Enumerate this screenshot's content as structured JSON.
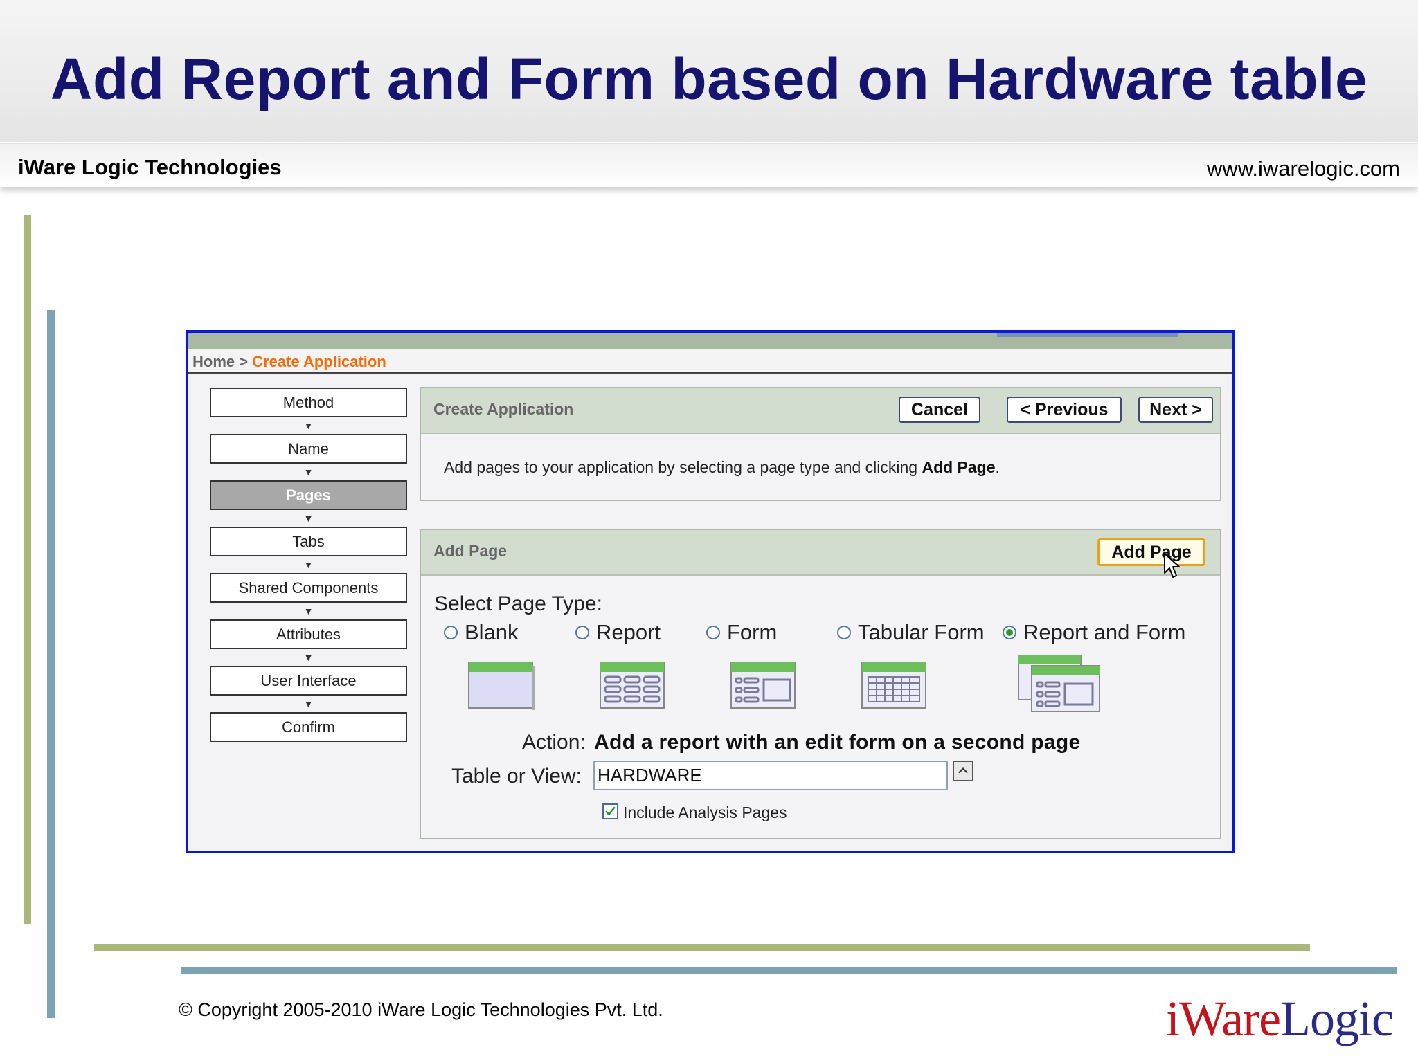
{
  "slide": {
    "title": "Add Report and Form based on Hardware table",
    "company": "iWare Logic Technologies",
    "url": "www.iwarelogic.com",
    "copyright": "© Copyright 2005-2010 iWare Logic Technologies Pvt. Ltd.",
    "logo_part1": "iWare",
    "logo_part2": "Logic"
  },
  "app": {
    "breadcrumb": {
      "home": "Home",
      "separator": " > ",
      "current": "Create Application"
    },
    "steps": [
      {
        "label": "Method",
        "active": false
      },
      {
        "label": "Name",
        "active": false
      },
      {
        "label": "Pages",
        "active": true
      },
      {
        "label": "Tabs",
        "active": false
      },
      {
        "label": "Shared Components",
        "active": false
      },
      {
        "label": "Attributes",
        "active": false
      },
      {
        "label": "User Interface",
        "active": false
      },
      {
        "label": "Confirm",
        "active": false
      }
    ],
    "create_panel": {
      "title": "Create Application",
      "cancel": "Cancel",
      "previous": "< Previous",
      "next": "Next >",
      "help_prefix": "Add pages to your application by selecting a page type and clicking ",
      "help_bold": "Add Page",
      "help_suffix": "."
    },
    "add_panel": {
      "title": "Add Page",
      "add_button": "Add Page",
      "select_label": "Select Page Type:",
      "page_types": [
        {
          "label": "Blank",
          "selected": false,
          "icon": "blank-page-icon"
        },
        {
          "label": "Report",
          "selected": false,
          "icon": "report-page-icon"
        },
        {
          "label": "Form",
          "selected": false,
          "icon": "form-page-icon"
        },
        {
          "label": "Tabular Form",
          "selected": false,
          "icon": "tabular-form-icon"
        },
        {
          "label": "Report and Form",
          "selected": true,
          "icon": "report-and-form-icon"
        }
      ],
      "action_label": "Action:",
      "action_value": "Add a report with an edit form on a second page",
      "table_label": "Table or View:",
      "table_value": "HARDWARE",
      "include_analysis_label": "Include Analysis Pages",
      "include_analysis_checked": true
    }
  }
}
